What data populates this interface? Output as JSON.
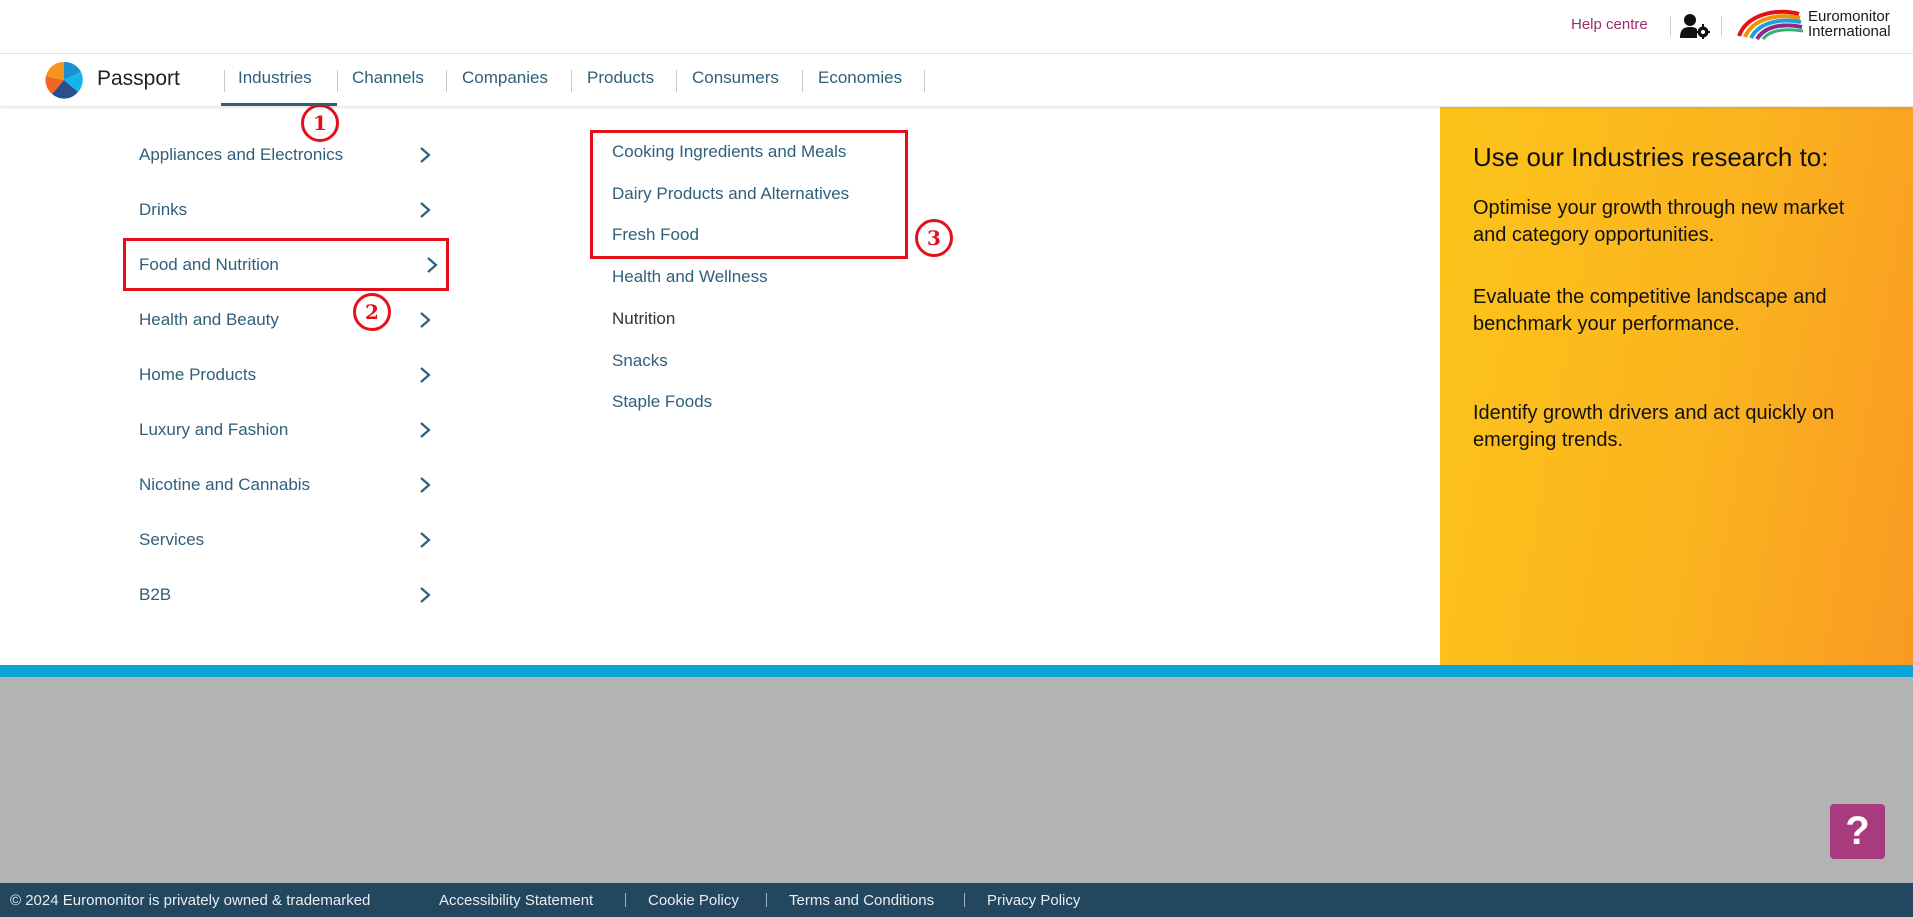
{
  "topbar": {
    "help_centre": "Help centre",
    "user_settings_icon": "user-gear-icon",
    "logo_text_line1": "Euromonitor",
    "logo_text_line2": "International"
  },
  "brand": {
    "name": "Passport",
    "icon": "passport-logo-icon"
  },
  "nav": {
    "items": [
      "Industries",
      "Channels",
      "Companies",
      "Products",
      "Consumers",
      "Economies"
    ],
    "active": "Industries"
  },
  "industries": {
    "categories": [
      "Appliances and Electronics",
      "Drinks",
      "Food and Nutrition",
      "Health and Beauty",
      "Home Products",
      "Luxury and Fashion",
      "Nicotine and Cannabis",
      "Services",
      "B2B"
    ],
    "selected": "Food and Nutrition",
    "subcategories": [
      "Cooking Ingredients and Meals",
      "Dairy Products and Alternatives",
      "Fresh Food",
      "Health and Wellness",
      "Nutrition",
      "Snacks",
      "Staple Foods"
    ]
  },
  "promo": {
    "title": "Use our Industries research to:",
    "points": [
      "Optimise your growth through new market and category opportunities.",
      "Evaluate the competitive landscape and benchmark your performance.",
      "Identify growth drivers and act quickly on emerging trends."
    ]
  },
  "help_button": {
    "label": "?"
  },
  "footer": {
    "copyright": "© 2024 Euromonitor is privately owned & trademarked",
    "links": [
      "Accessibility Statement",
      "Cookie Policy",
      "Terms and Conditions",
      "Privacy Policy"
    ]
  },
  "annotations": {
    "badges": [
      "1",
      "2",
      "3"
    ]
  },
  "colors": {
    "accent": "#2f5f7b",
    "help_link": "#9b2d6f",
    "promo_gradient_start": "#fcc41a",
    "promo_gradient_end": "#f99a22",
    "strip": "#0aa4d9",
    "footer_bg": "#23475e",
    "annotation": "#e3101a"
  }
}
